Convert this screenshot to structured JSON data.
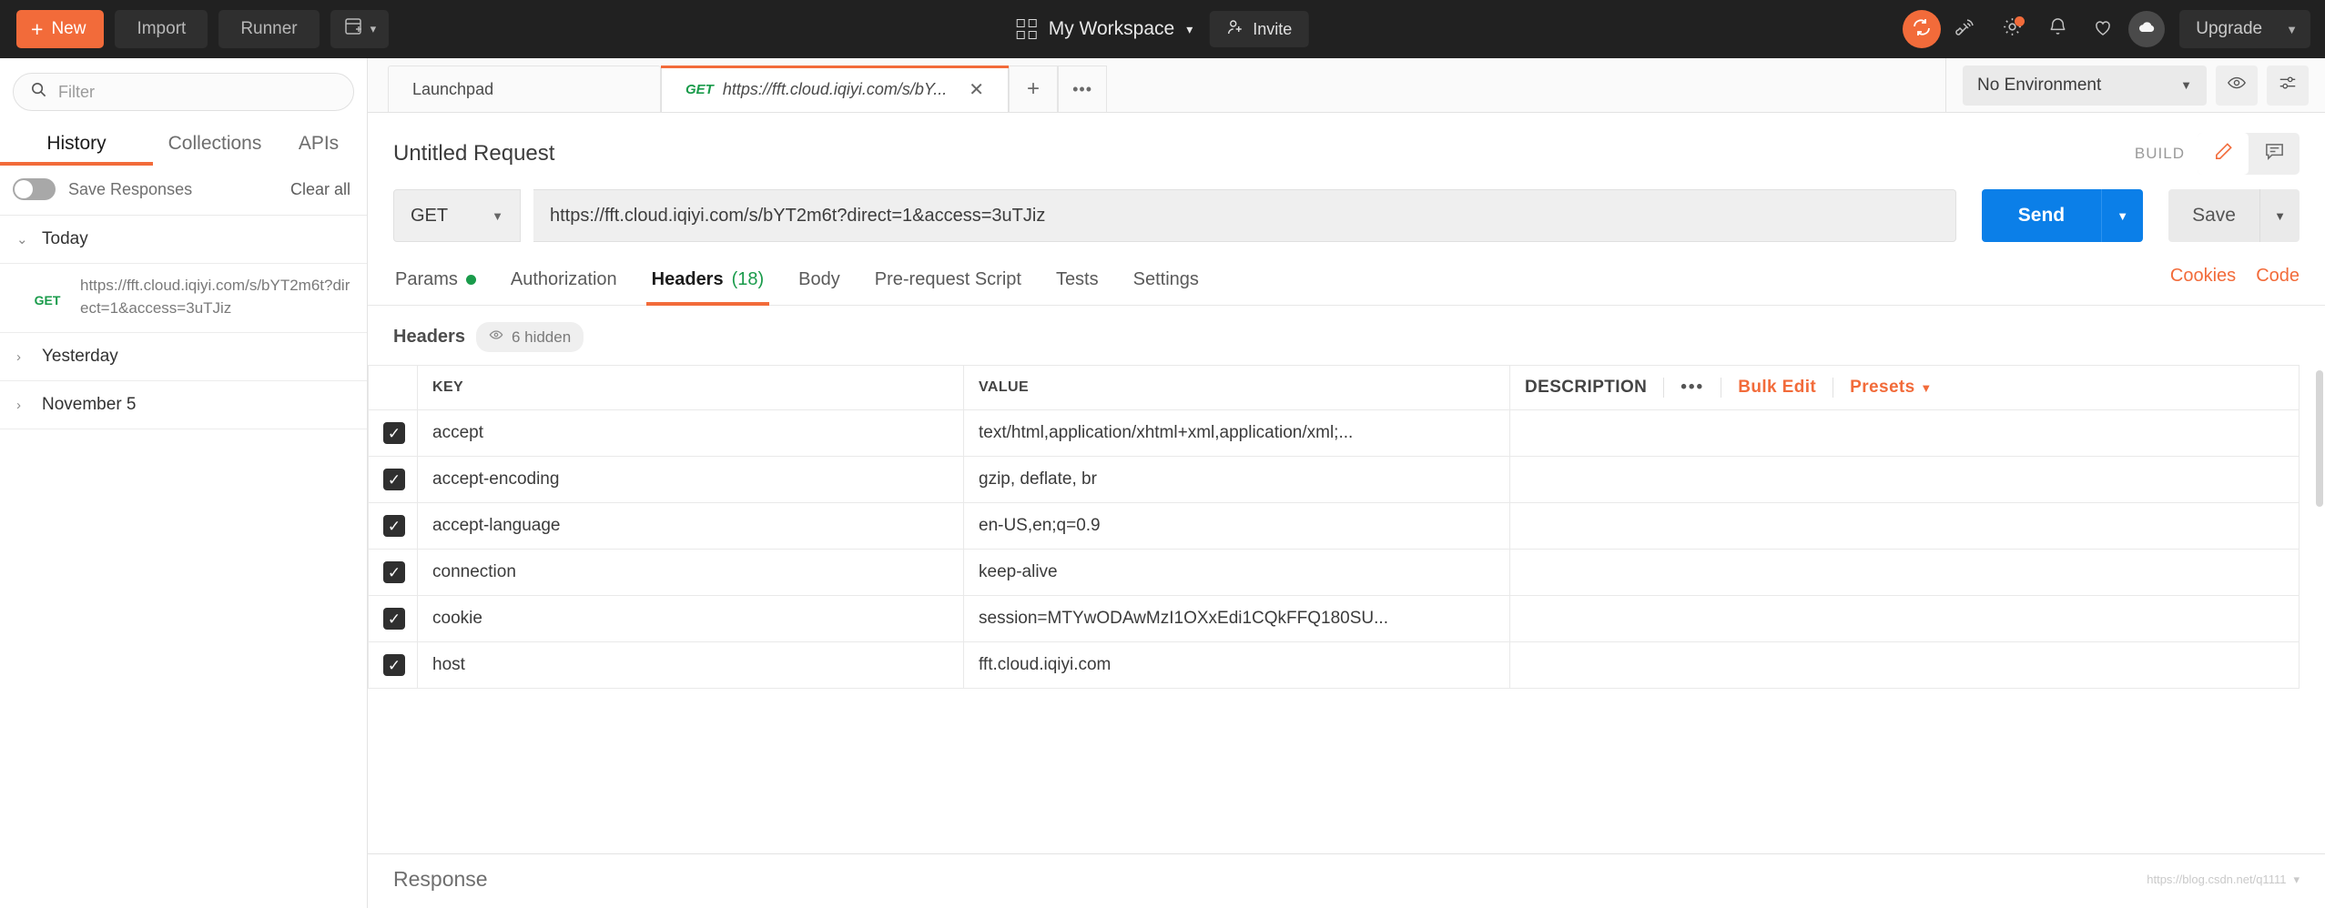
{
  "topbar": {
    "new_label": "New",
    "import_label": "Import",
    "runner_label": "Runner",
    "workspace_label": "My Workspace",
    "invite_label": "Invite",
    "upgrade_label": "Upgrade",
    "icons": {
      "new_plus": "plus-icon",
      "open_new_window": "new-window-icon",
      "sync": "sync-icon",
      "satellite": "satellite-icon",
      "settings": "gear-icon",
      "notifications": "bell-icon",
      "heart": "heart-icon",
      "cloud_avatar": "cloud-avatar-icon"
    },
    "accent": "#f26b3a",
    "background": "#212121"
  },
  "sidebar": {
    "filter_placeholder": "Filter",
    "filter_value": "",
    "tabs": [
      {
        "label": "History",
        "active": true
      },
      {
        "label": "Collections",
        "active": false
      },
      {
        "label": "APIs",
        "active": false
      }
    ],
    "save_responses_label": "Save Responses",
    "save_responses_on": false,
    "clear_all_label": "Clear all",
    "groups": [
      {
        "name": "Today",
        "expanded": true,
        "items": [
          {
            "method": "GET",
            "url": "https://fft.cloud.iqiyi.com/s/bYT2m6t?direct=1&access=3uTJiz"
          }
        ]
      },
      {
        "name": "Yesterday",
        "expanded": false,
        "items": []
      },
      {
        "name": "November 5",
        "expanded": false,
        "items": []
      }
    ]
  },
  "tabstrip": {
    "tabs": [
      {
        "label": "Launchpad",
        "method": "",
        "active": false
      },
      {
        "label": "https://fft.cloud.iqiyi.com/s/bY...",
        "method": "GET",
        "active": true
      }
    ],
    "new_tab_icon": "plus-icon",
    "more_tabs_icon": "ellipsis-icon",
    "environment_selected": "No Environment",
    "eye_icon": "eye-icon",
    "sliders_icon": "sliders-icon"
  },
  "request": {
    "title": "Untitled Request",
    "build_label": "BUILD",
    "edit_icon": "pencil-icon",
    "comment_icon": "comment-icon",
    "method": "GET",
    "url": "https://fft.cloud.iqiyi.com/s/bYT2m6t?direct=1&access=3uTJiz",
    "send_label": "Send",
    "save_label": "Save",
    "tabs": [
      {
        "label": "Params",
        "indicator": "dot",
        "active": false
      },
      {
        "label": "Authorization",
        "indicator": "",
        "active": false
      },
      {
        "label": "Headers",
        "count": "(18)",
        "indicator": "",
        "active": true
      },
      {
        "label": "Body",
        "indicator": "",
        "active": false
      },
      {
        "label": "Pre-request Script",
        "indicator": "",
        "active": false
      },
      {
        "label": "Tests",
        "indicator": "",
        "active": false
      },
      {
        "label": "Settings",
        "indicator": "",
        "active": false
      }
    ],
    "cookies_label": "Cookies",
    "code_label": "Code"
  },
  "headers_panel": {
    "section_title": "Headers",
    "hidden_label": "6 hidden",
    "hidden_icon": "eye-icon",
    "columns": [
      "KEY",
      "VALUE",
      "DESCRIPTION"
    ],
    "bulk_edit_label": "Bulk Edit",
    "presets_label": "Presets",
    "more_icon": "ellipsis-icon",
    "rows": [
      {
        "checked": true,
        "key": "accept",
        "value": "text/html,application/xhtml+xml,application/xml;...",
        "description": ""
      },
      {
        "checked": true,
        "key": "accept-encoding",
        "value": "gzip, deflate, br",
        "description": ""
      },
      {
        "checked": true,
        "key": "accept-language",
        "value": "en-US,en;q=0.9",
        "description": ""
      },
      {
        "checked": true,
        "key": "connection",
        "value": "keep-alive",
        "description": ""
      },
      {
        "checked": true,
        "key": "cookie",
        "value": "session=MTYwODAwMzI1OXxEdi1CQkFFQ180SU...",
        "description": ""
      },
      {
        "checked": true,
        "key": "host",
        "value": "fft.cloud.iqiyi.com",
        "description": ""
      }
    ]
  },
  "response": {
    "title": "Response"
  },
  "watermark": {
    "text": "https://blog.csdn.net/q1111"
  }
}
